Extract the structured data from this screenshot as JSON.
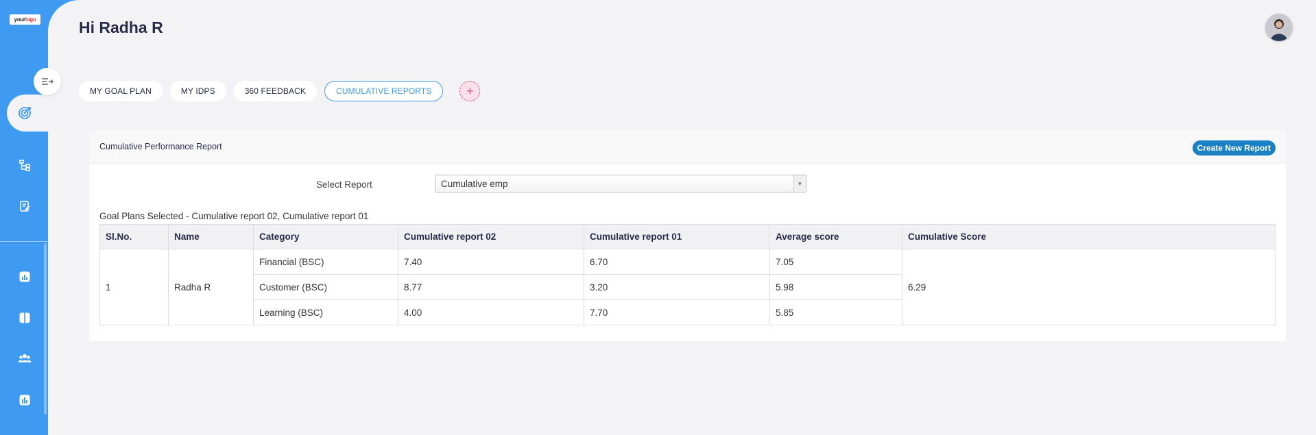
{
  "sidebar": {
    "logo_text_a": "your",
    "logo_text_b": "logo"
  },
  "header": {
    "greeting": "Hi Radha R"
  },
  "tabs": [
    {
      "label": "MY GOAL PLAN"
    },
    {
      "label": "MY IDPS"
    },
    {
      "label": "360 FEEDBACK"
    },
    {
      "label": "CUMULATIVE REPORTS"
    }
  ],
  "add_tab_symbol": "+",
  "card": {
    "title": "Cumulative Performance Report",
    "create_button": "Create New Report",
    "select_label": "Select Report",
    "select_value": "Cumulative emp",
    "selected_plans": "Goal Plans Selected - Cumulative report 02, Cumulative report 01"
  },
  "table": {
    "headers": [
      "Sl.No.",
      "Name",
      "Category",
      "Cumulative report 02",
      "Cumulative report 01",
      "Average score",
      "Cumulative Score"
    ],
    "sl_no": "1",
    "name": "Radha R",
    "cumulative_score": "6.29",
    "rows": [
      {
        "category": "Financial (BSC)",
        "r02": "7.40",
        "r01": "6.70",
        "avg": "7.05"
      },
      {
        "category": "Customer (BSC)",
        "r02": "8.77",
        "r01": "3.20",
        "avg": "5.98"
      },
      {
        "category": "Learning (BSC)",
        "r02": "4.00",
        "r01": "7.70",
        "avg": "5.85"
      }
    ]
  },
  "colors": {
    "accent": "#3f9bf2",
    "create_button": "#1a82c4",
    "add_tab": "#e8508a"
  }
}
